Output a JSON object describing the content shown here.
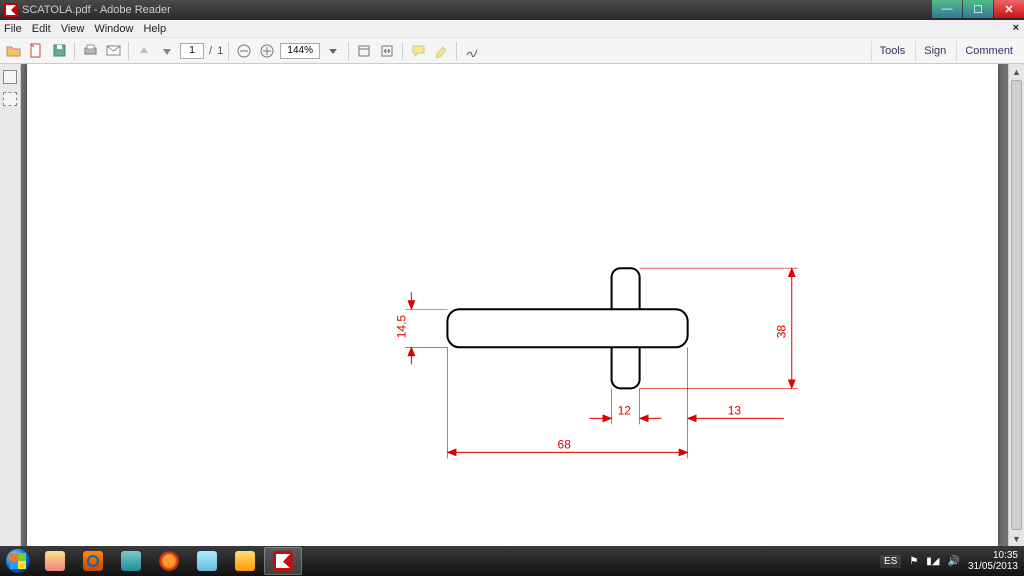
{
  "title": "SCATOLA.pdf - Adobe Reader",
  "menu": {
    "file": "File",
    "edit": "Edit",
    "view": "View",
    "window": "Window",
    "help": "Help"
  },
  "toolbar": {
    "page_current": "1",
    "page_sep": "/",
    "page_total": "1",
    "zoom": "144%"
  },
  "rightpanel": {
    "tools": "Tools",
    "sign": "Sign",
    "comment": "Comment"
  },
  "drawing": {
    "dim_h1": "14.5",
    "dim_h2": "38",
    "dim_w1": "12",
    "dim_w2": "13",
    "dim_w3": "68"
  },
  "tray": {
    "lang": "ES",
    "time": "10:35",
    "date": "31/05/2013"
  }
}
